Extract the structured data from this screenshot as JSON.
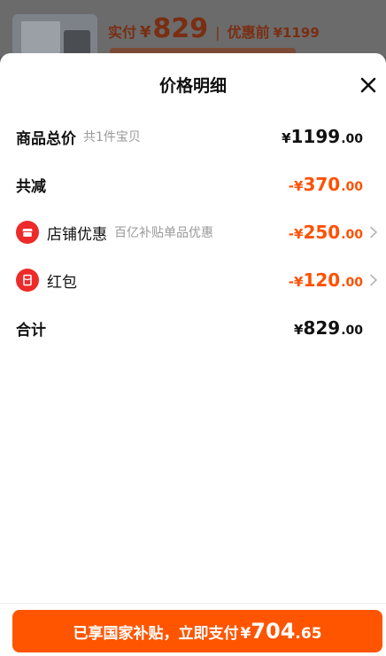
{
  "background": {
    "paid_label": "实付",
    "currency": "¥",
    "paid_amount": "829",
    "separator": "|",
    "original_label": "优惠前",
    "original_price": "¥1199"
  },
  "sheet": {
    "title": "价格明细"
  },
  "rows": {
    "goods_total": {
      "label": "商品总价",
      "sub": "共1件宝贝",
      "currency": "¥",
      "amount": "1199",
      "decimal": ".00"
    },
    "total_discount": {
      "label": "共减",
      "currency": "-¥",
      "amount": "370",
      "decimal": ".00"
    },
    "store_discount": {
      "label": "店铺优惠",
      "sub": "百亿补贴单品优惠",
      "currency": "-¥",
      "amount": "250",
      "decimal": ".00"
    },
    "red_packet": {
      "label": "红包",
      "currency": "-¥",
      "amount": "120",
      "decimal": ".00"
    },
    "sum": {
      "label": "合计",
      "currency": "¥",
      "amount": "829",
      "decimal": ".00"
    }
  },
  "pay_button": {
    "text": "已享国家补贴，立即支付",
    "currency": "¥",
    "amount": "704",
    "decimal": ".65"
  },
  "colors": {
    "accent": "#ff5000",
    "button": "#ff5500",
    "badge": "#ee2a2a"
  },
  "icons": [
    "store-icon",
    "red-packet-icon",
    "close-icon",
    "chevron-right-icon"
  ]
}
